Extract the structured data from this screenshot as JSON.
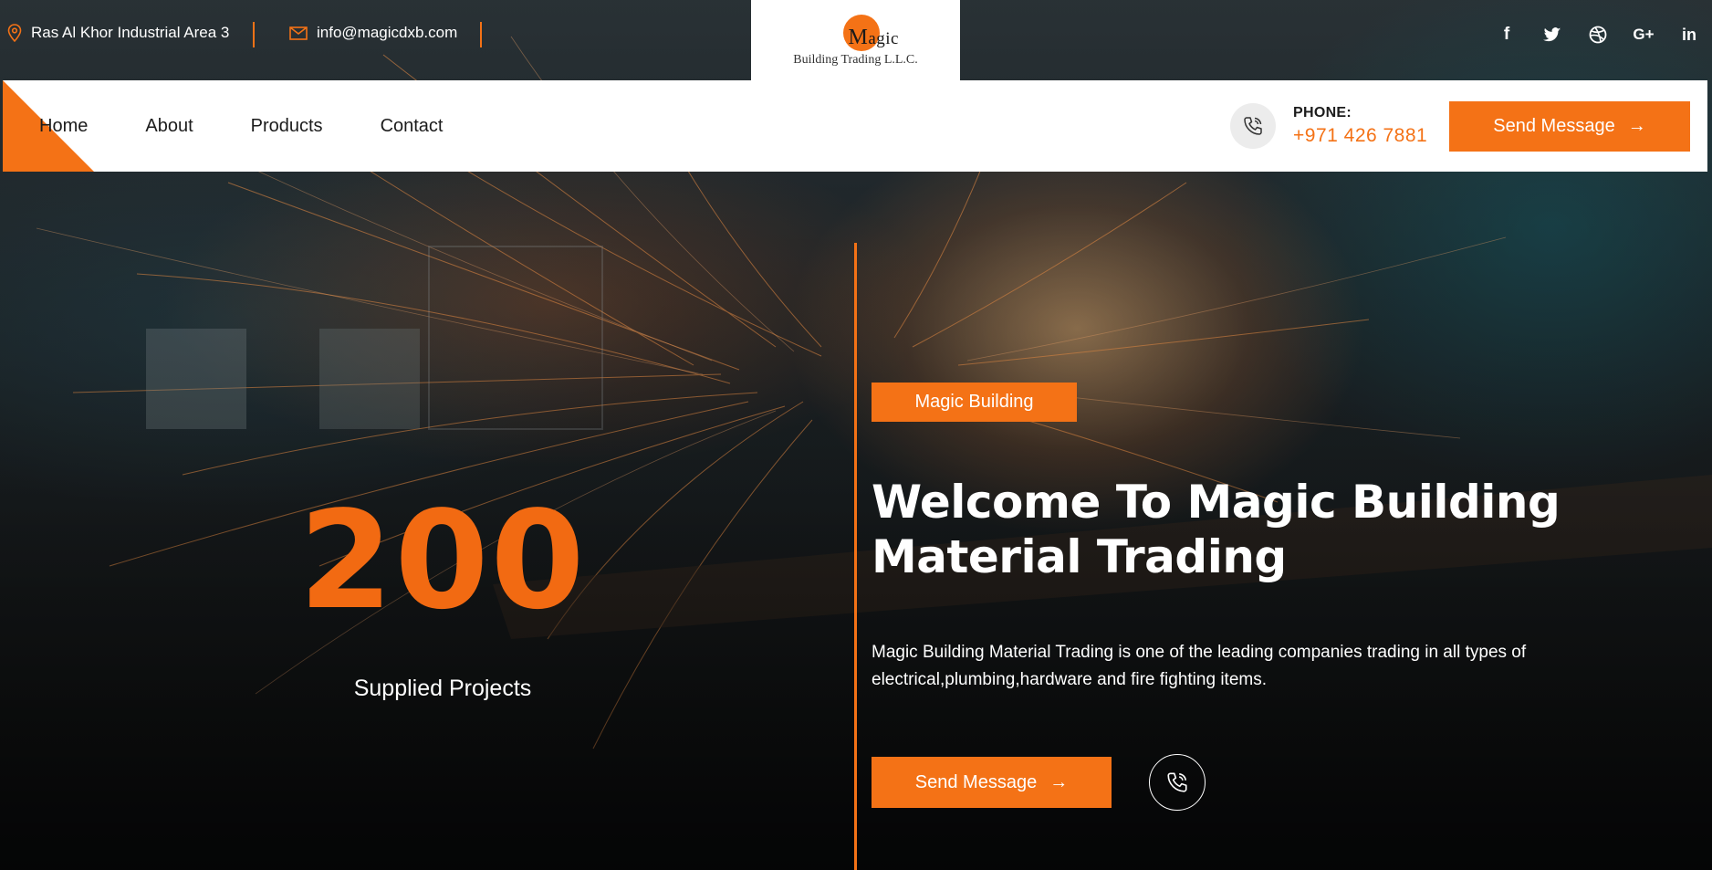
{
  "topbar": {
    "address": "Ras Al Khor Industrial Area 3",
    "email": "info@magicdxb.com",
    "socials": [
      "facebook-icon",
      "twitter-icon",
      "dribbble-icon",
      "google-plus-icon",
      "linkedin-icon"
    ],
    "social_glyphs": {
      "facebook": "f",
      "google_plus": "G+",
      "linkedin": "in"
    }
  },
  "logo": {
    "initial": "M",
    "word_rest": "agic",
    "subtitle": "Building Trading L.L.C."
  },
  "nav": {
    "items": [
      "Home",
      "About",
      "Products",
      "Contact"
    ],
    "phone_label": "PHONE:",
    "phone_number": "+971 426 7881",
    "cta_label": "Send Message",
    "cta_arrow": "→"
  },
  "hero": {
    "stat_number": "200",
    "stat_label": "Supplied Projects",
    "tag": "Magic Building",
    "title": "Welcome To Magic Building Material Trading",
    "description": "Magic Building Material Trading is one of the leading companies trading in all types of electrical,plumbing,hardware and fire fighting items.",
    "cta_label": "Send Message",
    "cta_arrow": "→"
  },
  "colors": {
    "accent": "#f47216",
    "nav_bg": "#ffffff",
    "text_dark": "#1c1c1c"
  }
}
